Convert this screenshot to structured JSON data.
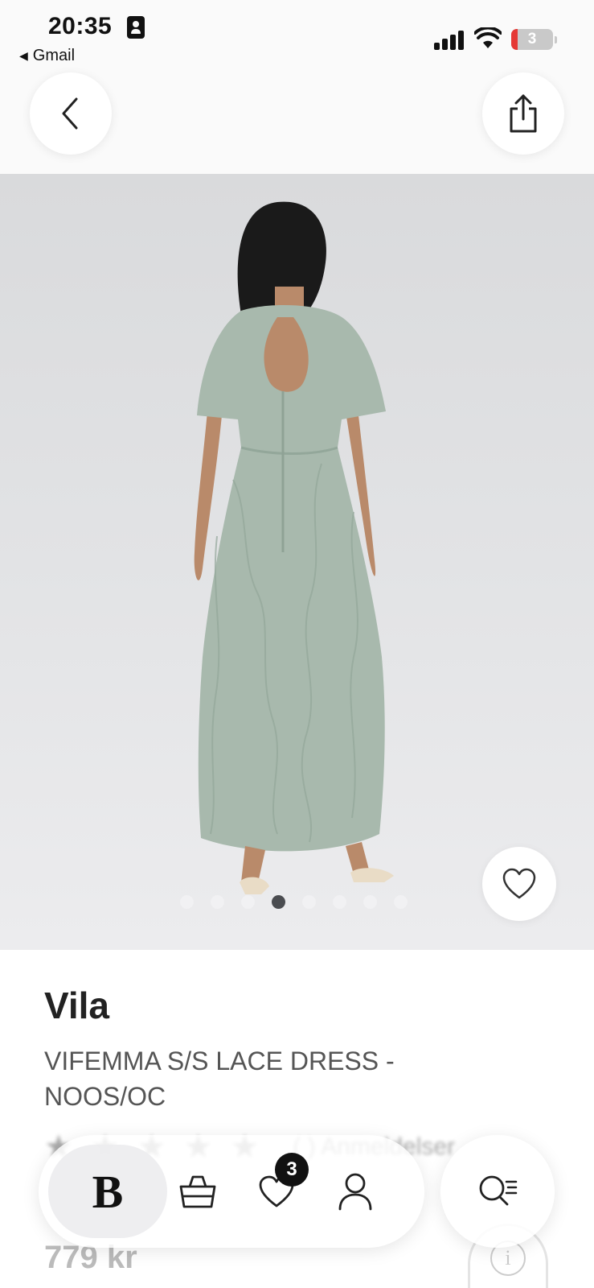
{
  "status_bar": {
    "time": "20:35",
    "back_app": "Gmail",
    "battery_level": "3"
  },
  "product": {
    "brand": "Vila",
    "name": "VIFEMMA S/S LACE DRESS - NOOS/OC",
    "rating_text": "(  ) Anmeldelser",
    "price": "779 kr",
    "image_count": 8,
    "active_image_index": 3
  },
  "bottom_nav": {
    "logo": "B",
    "favorites_count": "3"
  },
  "colors": {
    "dress": "#a8b9ad",
    "background": "#e2e3e5",
    "badge": "#111111"
  },
  "icons": [
    "back-icon",
    "share-icon",
    "heart-icon",
    "bag-icon",
    "heart-icon",
    "user-icon",
    "search-filter-icon",
    "info-icon"
  ]
}
